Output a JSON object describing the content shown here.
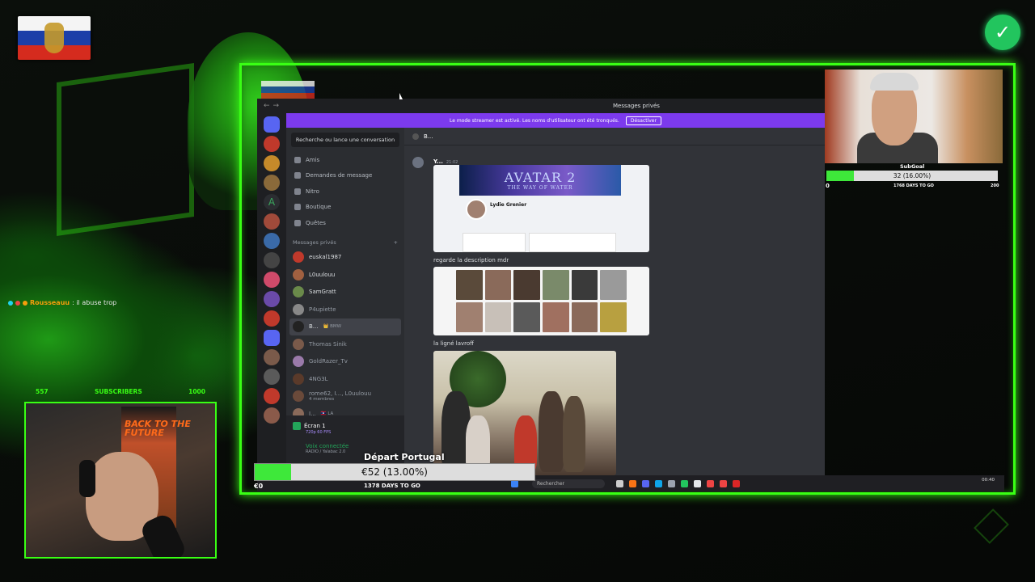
{
  "overlay": {
    "chat": {
      "user": "Rousseauu",
      "message": ": il abuse trop"
    },
    "subscribers": {
      "left": "557",
      "label": "SUBSCRIBERS",
      "right": "1000"
    },
    "poster_text": "BACK TO THE FUTURE",
    "sub_goal": {
      "label": "SubGoal",
      "value_text": "32 (16.00%)",
      "progress": 0.16,
      "left": "0",
      "days": "1768 DAYS TO GO",
      "right": "200"
    },
    "donation_goal": {
      "title": "Départ Portugal",
      "value_text": "€52 (13.00%)",
      "progress": 0.13,
      "left": "€0",
      "days": "1378 DAYS TO GO"
    }
  },
  "discord": {
    "window_title": "Messages privés",
    "streamer_banner": "Le mode streamer est activé. Les noms d'utilisateur ont été tronqués.",
    "disable_button": "Désactiver",
    "search_placeholder": "Recherche ou lance une conversation",
    "nav": [
      {
        "label": "Amis",
        "icon": "friends-icon"
      },
      {
        "label": "Demandes de message",
        "icon": "mail-icon"
      },
      {
        "label": "Nitro",
        "icon": "nitro-icon"
      },
      {
        "label": "Boutique",
        "icon": "shop-icon"
      },
      {
        "label": "Quêtes",
        "icon": "quest-icon"
      }
    ],
    "dm_section": "Messages privés",
    "dm_add": "+",
    "dms": [
      {
        "name": "euskal1987",
        "color": "#c0392b"
      },
      {
        "name": "L0uulouu",
        "color": "#a06040"
      },
      {
        "name": "SamGratt",
        "color": "#6a8a4a"
      },
      {
        "name": "P4upiette",
        "color": "#888"
      },
      {
        "name": "B...",
        "badge": "👑 BMW",
        "color": "#222"
      },
      {
        "name": "Thomas Sinik",
        "color": "#7a5a4a"
      },
      {
        "name": "GoldRazer_Tv",
        "color": "#9a7aaa"
      },
      {
        "name": "4NG3L",
        "color": "#5a3a2a"
      },
      {
        "name": "rome62, I..., L0uulouu",
        "sub": "4 membres",
        "color": "#6a4a3a"
      },
      {
        "name": "I...",
        "badge": "🇱🇦 LA",
        "color": "#8a6a5a"
      }
    ],
    "voice": {
      "screen": "Écran 1",
      "screen_sub": "720p 60 FPS",
      "status": "Voix connectée",
      "channel": "RADIO / Yalabac 2.0"
    },
    "channel_header": "B...",
    "message": {
      "author": "Y...",
      "time": "21:02"
    },
    "avatar_banner": "AVATAR 2",
    "avatar_sub": "THE WAY OF WATER",
    "profile_name": "Lydie Grenier",
    "caption1": "regarde la description mdr",
    "caption2": "la ligné lavroff"
  },
  "taskbar": {
    "search": "Rechercher",
    "time": "00:40"
  },
  "colors": {
    "accent": "#39ff14",
    "discord_blurple": "#5865f2",
    "streamer_purple": "#7c3aed",
    "goal_fill": "#3ee83a"
  }
}
